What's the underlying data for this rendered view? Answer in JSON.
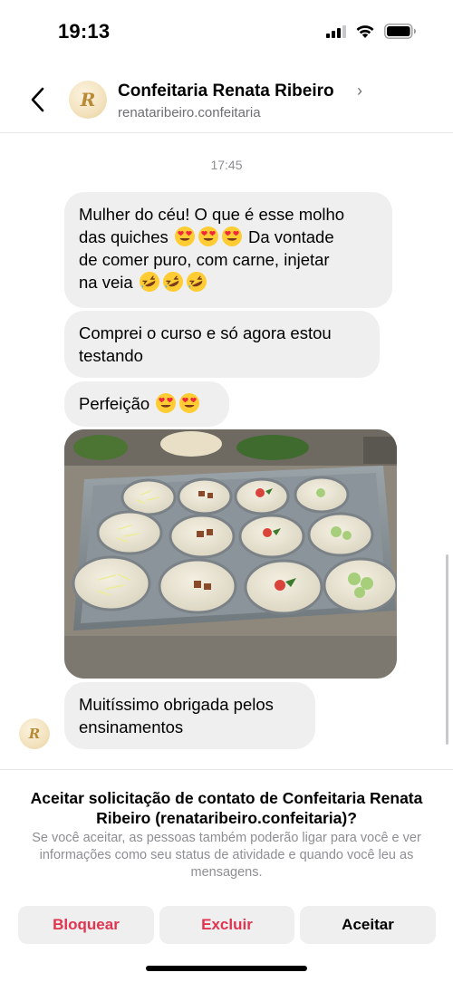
{
  "status_bar": {
    "time": "19:13"
  },
  "header": {
    "back_icon": "chevron-left-icon",
    "avatar_letter": "R",
    "contact_name": "Confeitaria Renata Ribeiro",
    "chevron": "›",
    "username": "renataribeiro.confeitaria"
  },
  "chat": {
    "timestamp": "17:45",
    "messages": [
      {
        "line1": "Mulher do céu! O que é esse molho",
        "line2": "das quiches",
        "line2_emoji": "heart-eyes-emoji",
        "line2_tail": "Da vontade",
        "line3": "de comer puro, com carne, injetar",
        "line4": "na veia",
        "line4_emoji": "rolling-on-floor-laughing-emoji"
      },
      {
        "line1": "Comprei o curso e só agora estou",
        "line2": "testando"
      },
      {
        "text": "Perfeição",
        "emoji": "heart-eyes-emoji"
      },
      {
        "type": "photo",
        "subject": "quiches-in-baking-tray"
      },
      {
        "line1": "Muitíssimo obrigada pelos",
        "line2": "ensinamentos"
      }
    ]
  },
  "request": {
    "title": "Aceitar solicitação de contato de Confeitaria Renata Ribeiro (renataribeiro.confeitaria)?",
    "description": "Se você aceitar, as pessoas também poderão ligar para você e ver informações como seu status de atividade e quando você leu as mensagens.",
    "buttons": {
      "block": "Bloquear",
      "delete": "Excluir",
      "accept": "Aceitar"
    }
  },
  "colors": {
    "bubble": "#efefef",
    "destructive": "#e0344f",
    "secondary_text": "#8e8e93",
    "avatar_gold": "#b98a35"
  }
}
